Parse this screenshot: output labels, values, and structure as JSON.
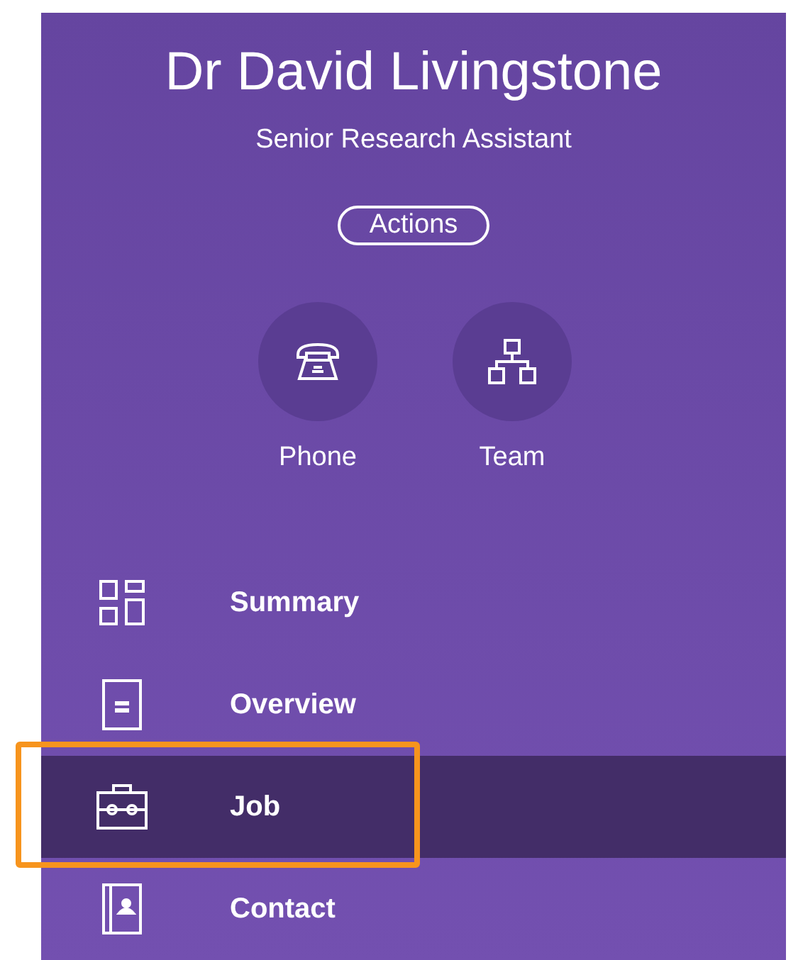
{
  "profile": {
    "name": "Dr David Livingstone",
    "title": "Senior Research Assistant",
    "actions_button": "Actions"
  },
  "quick_actions": [
    {
      "kind": "phone",
      "label": "Phone"
    },
    {
      "kind": "team",
      "label": "Team"
    }
  ],
  "nav": [
    {
      "kind": "summary",
      "label": "Summary",
      "selected": false,
      "highlighted": false
    },
    {
      "kind": "overview",
      "label": "Overview",
      "selected": false,
      "highlighted": false
    },
    {
      "kind": "job",
      "label": "Job",
      "selected": true,
      "highlighted": true
    },
    {
      "kind": "contact",
      "label": "Contact",
      "selected": false,
      "highlighted": false
    }
  ]
}
